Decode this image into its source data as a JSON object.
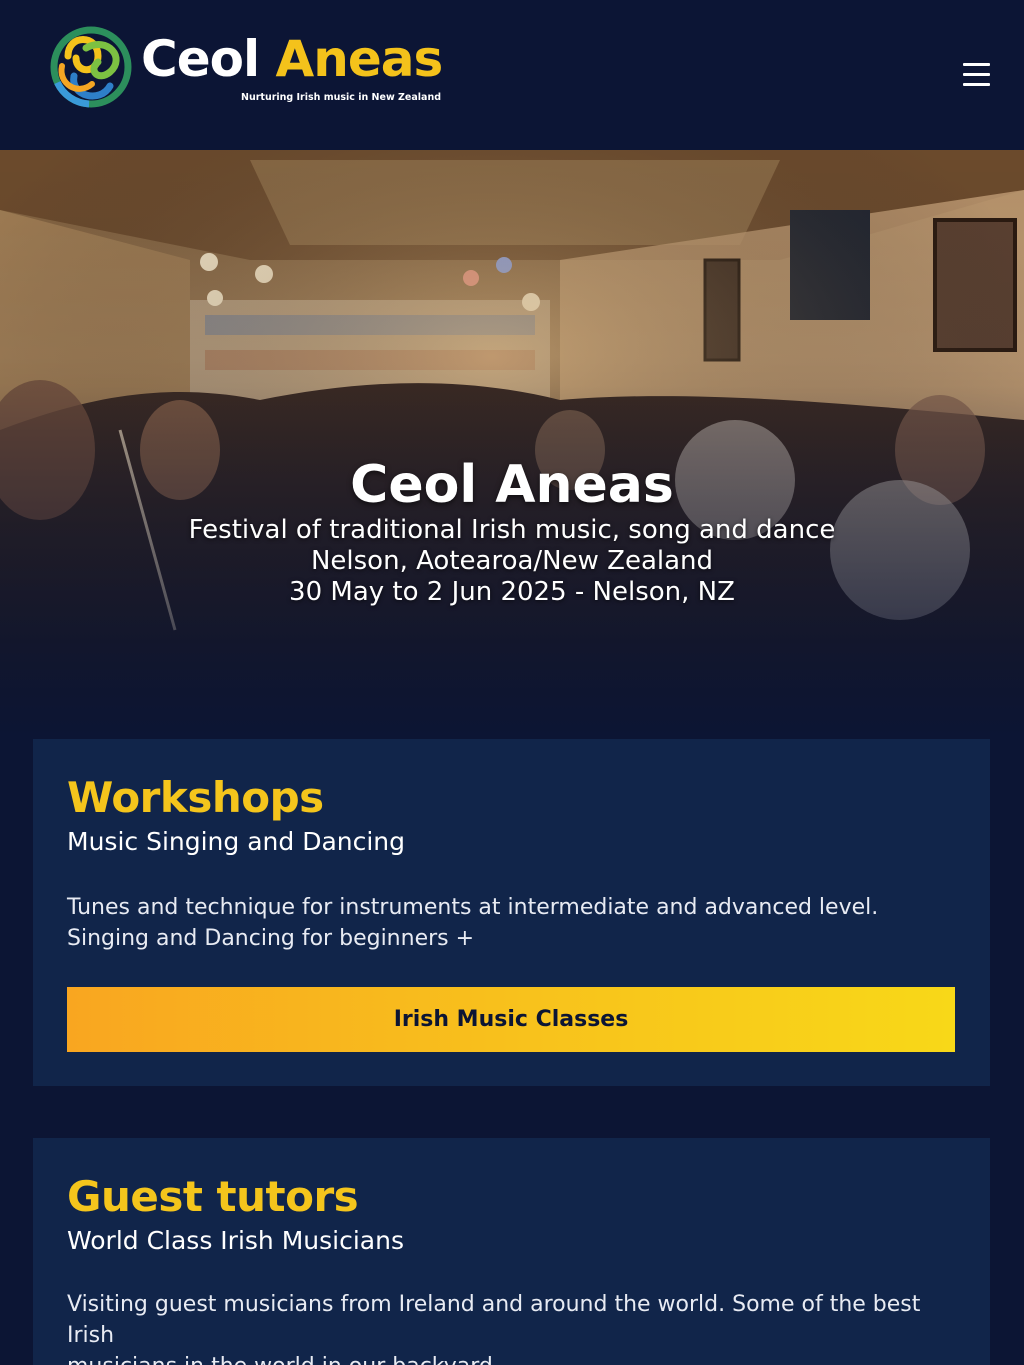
{
  "header": {
    "brand_word1": "Ceol",
    "brand_word2": "Aneas",
    "tagline": "Nurturing Irish music in New Zealand",
    "menu_icon": "hamburger-menu-icon"
  },
  "hero": {
    "title": "Ceol Aneas",
    "line1": "Festival of traditional Irish music, song and dance",
    "line2": "Nelson, Aotearoa/New Zealand",
    "line3": "30 May to 2 Jun 2025 - Nelson, NZ"
  },
  "workshops": {
    "title": "Workshops",
    "subtitle": "Music Singing and Dancing",
    "body_line1": "Tunes and technique for instruments at intermediate and advanced level.",
    "body_line2": "Singing and Dancing for beginners +",
    "button_label": "Irish Music Classes"
  },
  "tutors": {
    "title": "Guest tutors",
    "subtitle": "World Class Irish Musicians",
    "body_line1": "Visiting guest musicians from Ireland and around the world. Some of the best Irish",
    "body_line2": "musicians in the world in our backyard."
  },
  "colors": {
    "background": "#0c1534",
    "card": "#11254a",
    "accent_yellow": "#f4c51c",
    "button_gradient_start": "#f9a620",
    "button_gradient_end": "#f8d818"
  }
}
